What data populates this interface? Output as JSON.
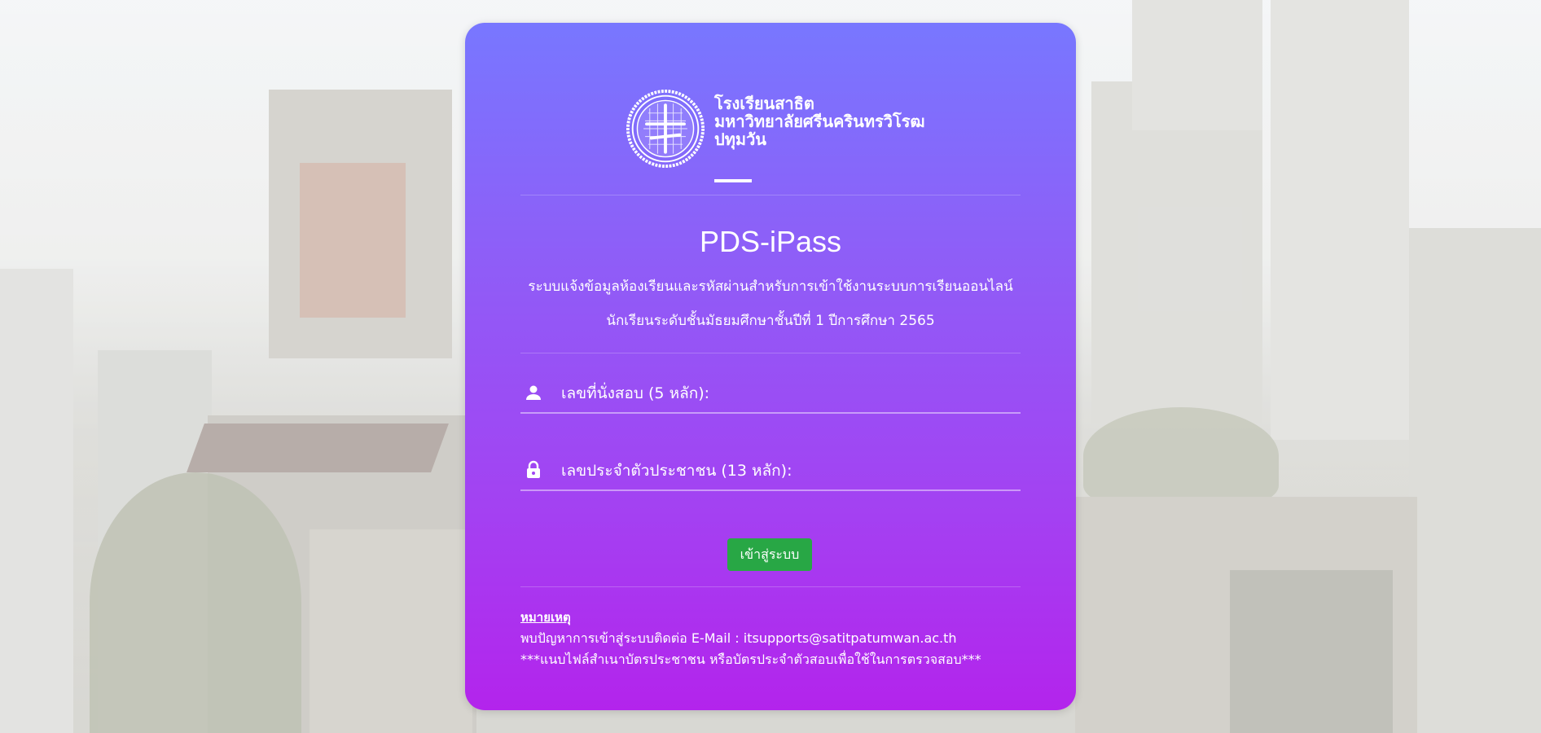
{
  "logo": {
    "line1": "โรงเรียนสาธิต",
    "line2": "มหาวิทยาลัยศรีนครินทรวิโรฒ",
    "line3": "ปทุมวัน"
  },
  "app": {
    "title": "PDS-iPass",
    "subtitle_line1": "ระบบแจ้งข้อมูลห้องเรียนและรหัสผ่านสำหรับการเข้าใช้งานระบบการเรียนออนไลน์",
    "subtitle_line2": "นักเรียนระดับชั้นมัธยมศึกษาชั้นปีที่ 1 ปีการศึกษา 2565"
  },
  "form": {
    "seat_number": {
      "placeholder": "เลขที่นั่งสอบ (5 หลัก):",
      "value": "",
      "icon": "person-icon"
    },
    "citizen_id": {
      "placeholder": "เลขประจำตัวประชาชน (13 หลัก):",
      "value": "",
      "icon": "lock-icon"
    },
    "submit_label": "เข้าสู่ระบบ"
  },
  "notes": {
    "heading": "หมายเหตุ",
    "contact": "พบปัญหาการเข้าสู่ระบบติดต่อ E-Mail : itsupports@satitpatumwan.ac.th",
    "attachment": "***แนบไฟล์สำเนาบัตรประชาชน หรือบัตรประจำตัวสอบเพื่อใช้ในการตรวจสอบ***"
  },
  "colors": {
    "card_top": "#7877ff",
    "card_bottom": "#b324ec",
    "button": "#28a745",
    "text": "#ffffff"
  }
}
